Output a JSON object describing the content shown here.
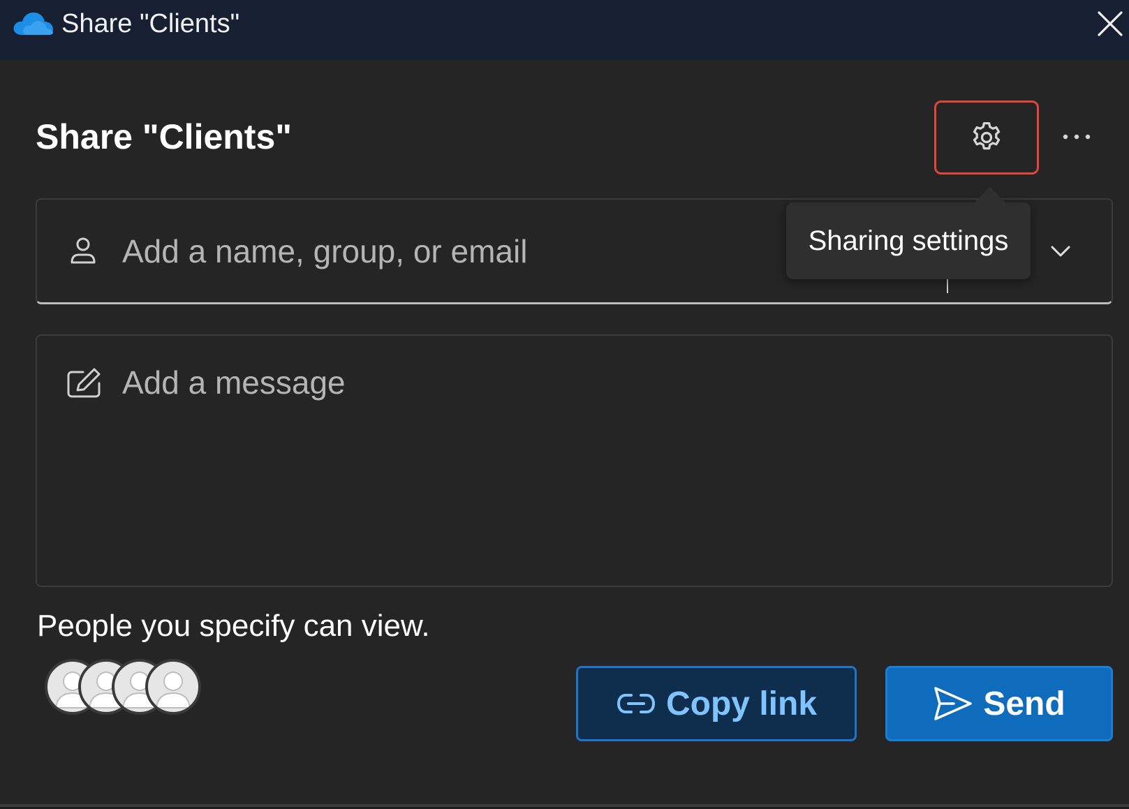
{
  "window": {
    "title": "Share \"Clients\"",
    "app_icon": "onedrive-cloud-icon",
    "close_icon": "close-icon"
  },
  "dialog": {
    "heading": "Share \"Clients\"",
    "settings_icon": "gear-icon",
    "more_icon": "more-horizontal-icon",
    "tooltip": "Sharing settings"
  },
  "recipient": {
    "placeholder": "Add a name, group, or email",
    "value": "",
    "icon": "person-icon",
    "dropdown_icon": "chevron-down-icon"
  },
  "message": {
    "placeholder": "Add a message",
    "value": "",
    "icon": "edit-icon"
  },
  "permission_text": "People you specify can view.",
  "avatars": {
    "count": 4,
    "icon": "person-avatar-icon"
  },
  "actions": {
    "copy_link_label": "Copy link",
    "copy_link_icon": "link-icon",
    "send_label": "Send",
    "send_icon": "send-icon"
  },
  "colors": {
    "titlebar": "#172032",
    "panel": "#252525",
    "highlight_border": "#e0463c",
    "send_button": "#0f6cbd",
    "copy_link_text": "#7fc3ff"
  }
}
